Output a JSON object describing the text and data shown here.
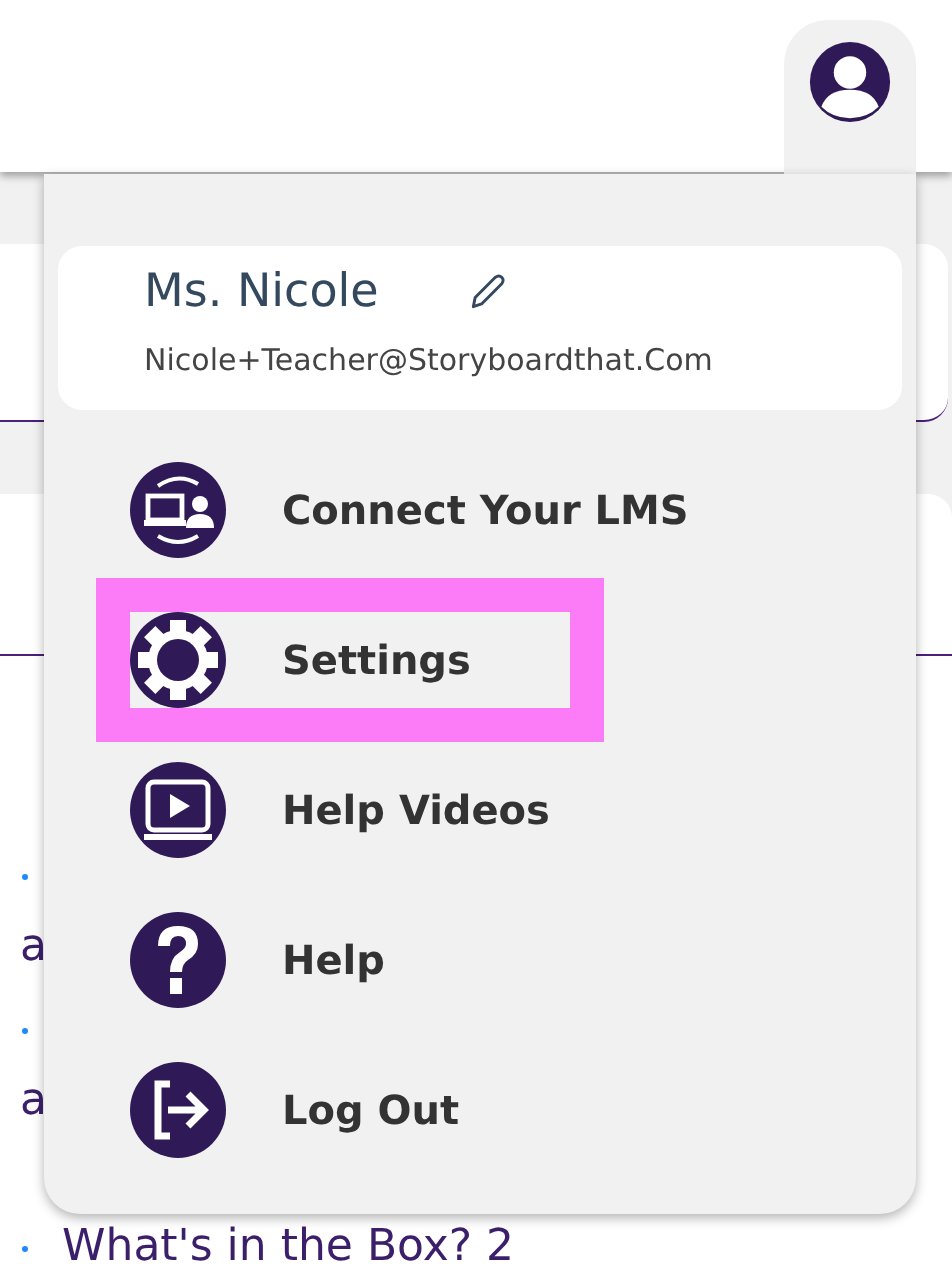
{
  "background_list": [
    {
      "kind": "wrapped",
      "text": "a"
    },
    {
      "kind": "wrapped",
      "text": "a"
    },
    {
      "kind": "inline",
      "text": "What's in the Box? 2"
    }
  ],
  "user_menu": {
    "name": "Ms. Nicole",
    "email": "Nicole+Teacher@Storyboardthat.Com",
    "items": [
      {
        "kind": "lms",
        "label": "Connect Your LMS",
        "highlighted": false
      },
      {
        "kind": "settings",
        "label": "Settings",
        "highlighted": true
      },
      {
        "kind": "videos",
        "label": "Help Videos",
        "highlighted": false
      },
      {
        "kind": "help",
        "label": "Help",
        "highlighted": false
      },
      {
        "kind": "logout",
        "label": "Log Out",
        "highlighted": false
      }
    ]
  }
}
